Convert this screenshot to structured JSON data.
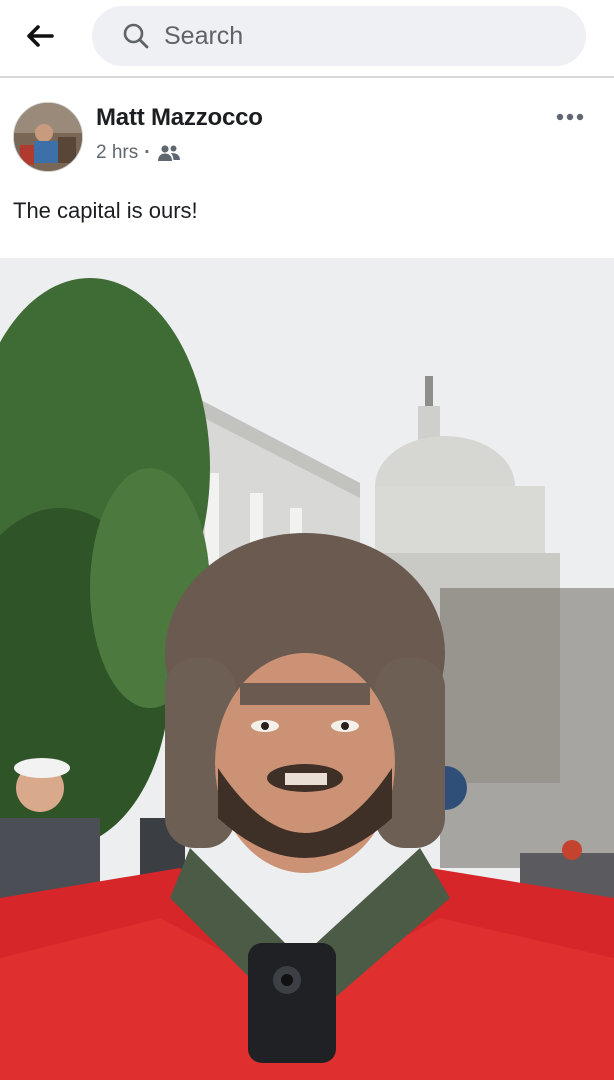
{
  "header": {
    "back_icon": "arrow-left-icon",
    "search": {
      "placeholder": "Search",
      "icon": "search-icon"
    }
  },
  "post": {
    "author": "Matt Mazzocco",
    "time": "2 hrs",
    "audience_icon": "friends-icon",
    "more_icon": "more-horizontal-icon",
    "text": "The capital is ours!",
    "photo_subject": "selfie-photo"
  },
  "colors": {
    "text": "#1c1e21",
    "secondary": "#606770",
    "search_bg": "#eef0f3",
    "divider": "#d9d9d9"
  }
}
